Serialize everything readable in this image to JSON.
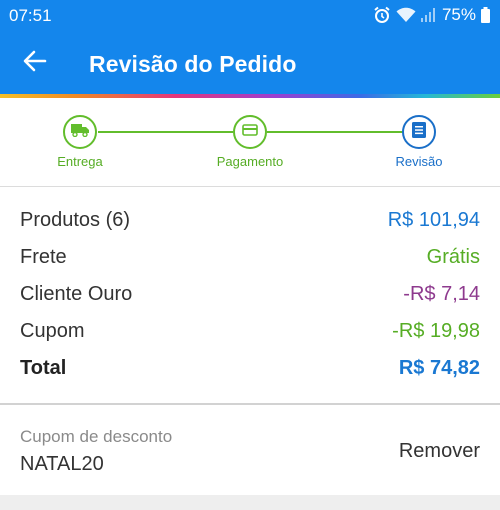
{
  "status_bar": {
    "time": "07:51",
    "battery": "75%"
  },
  "header": {
    "title": "Revisão do Pedido"
  },
  "stepper": {
    "steps": [
      {
        "label": "Entrega",
        "icon": "truck-icon",
        "state": "done"
      },
      {
        "label": "Pagamento",
        "icon": "credit-card-icon",
        "state": "done"
      },
      {
        "label": "Revisão",
        "icon": "document-list-icon",
        "state": "active"
      }
    ]
  },
  "summary": {
    "rows": [
      {
        "label": "Produtos (6)",
        "value": "R$ 101,94",
        "color": "#1a78d2"
      },
      {
        "label": "Frete",
        "value": "Grátis",
        "color": "#56ad25"
      },
      {
        "label": "Cliente Ouro",
        "value": "-R$ 7,14",
        "color": "#8e3a8e"
      },
      {
        "label": "Cupom",
        "value": "-R$ 19,98",
        "color": "#56ad25"
      }
    ],
    "total": {
      "label": "Total",
      "value": "R$ 74,82",
      "color": "#1a78d2"
    }
  },
  "coupon": {
    "label": "Cupom de desconto",
    "code": "NATAL20",
    "remove_label": "Remover"
  },
  "colors": {
    "header": "#1486ec",
    "step_done": "#62bd2c",
    "step_active": "#1a6fc8"
  }
}
